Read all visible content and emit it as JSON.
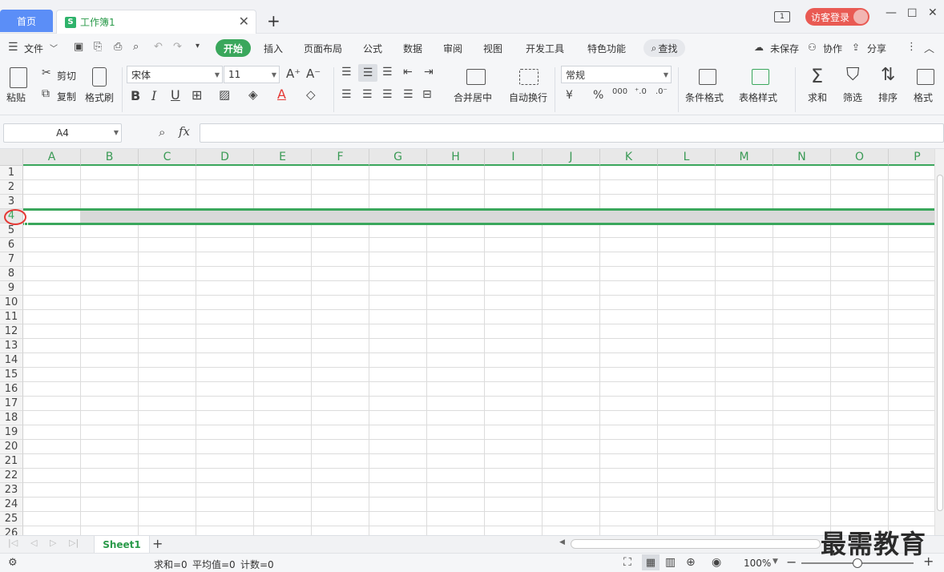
{
  "tabs": {
    "home": "首页",
    "doc": "工作簿1",
    "doc_icon": "S"
  },
  "titlebar": {
    "window_badge": "1",
    "guest_login": "访客登录"
  },
  "menu": {
    "file": "文件",
    "items": [
      "开始",
      "插入",
      "页面布局",
      "公式",
      "数据",
      "审阅",
      "视图",
      "开发工具",
      "特色功能"
    ],
    "search": "查找",
    "unsaved": "未保存",
    "collab": "协作",
    "share": "分享"
  },
  "ribbon": {
    "paste": "粘贴",
    "cut": "剪切",
    "copy": "复制",
    "format_painter": "格式刷",
    "font_name": "宋体",
    "font_size": "11",
    "merge_center": "合并居中",
    "wrap_text": "自动换行",
    "number_format": "常规",
    "currency": "¥",
    "percent": "%",
    "thousands": "000",
    "cond_format": "条件格式",
    "table_style": "表格样式",
    "sum": "求和",
    "filter": "筛选",
    "sort": "排序",
    "format": "格式"
  },
  "formula_bar": {
    "cell_ref": "A4",
    "fx": "fx"
  },
  "grid": {
    "columns": [
      "A",
      "B",
      "C",
      "D",
      "E",
      "F",
      "G",
      "H",
      "I",
      "J",
      "K",
      "L",
      "M",
      "N",
      "O",
      "P"
    ],
    "rows": [
      "1",
      "2",
      "3",
      "4",
      "5",
      "6",
      "7",
      "8",
      "9",
      "10",
      "11",
      "12",
      "13",
      "14",
      "15",
      "16",
      "17",
      "18",
      "19",
      "20",
      "21",
      "22",
      "23",
      "24",
      "25",
      "26"
    ],
    "selected_row": "4",
    "accent": "#3aa75c",
    "highlight_circle": "#e53935"
  },
  "sheets": {
    "active": "Sheet1"
  },
  "status": {
    "sum": "求和=0",
    "avg": "平均值=0",
    "count": "计数=0",
    "zoom": "100%"
  },
  "watermark": "最需教育"
}
